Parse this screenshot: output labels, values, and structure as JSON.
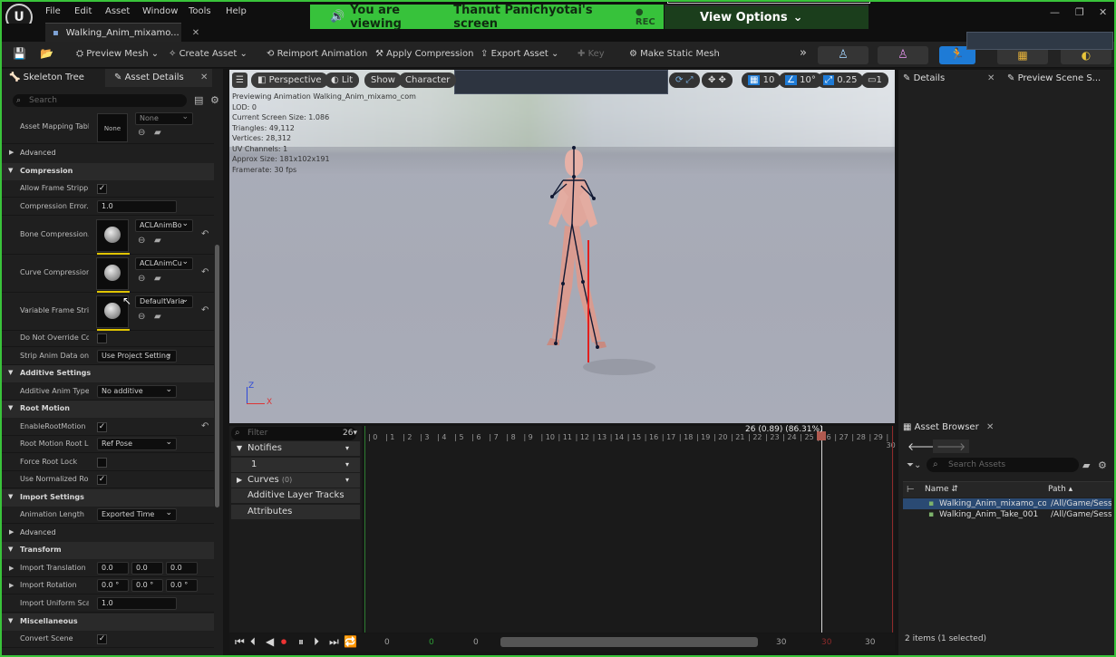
{
  "menubar": {
    "logo": "U",
    "items": [
      "File",
      "Edit",
      "Asset",
      "Window",
      "Tools",
      "Help"
    ],
    "window_controls": [
      "—",
      "❐",
      "✕"
    ]
  },
  "share_banner": {
    "text": "You are viewing",
    "presenter": "Thanut Panichyotai's screen",
    "rec": "● REC",
    "view_options": "View Options"
  },
  "document_tab": {
    "label": "Walking_Anim_mixamo...",
    "close": "✕"
  },
  "toolbar": {
    "preview_mesh": "Preview Mesh",
    "create_asset": "Create Asset",
    "reimport_animation": "Reimport Animation",
    "apply_compression": "Apply Compression",
    "export_asset": "Export Asset",
    "key": "Key",
    "make_static_mesh": "Make Static Mesh"
  },
  "left_panel": {
    "tabs": [
      "Skeleton Tree",
      "Asset Details"
    ],
    "search_placeholder": "Search",
    "asset_mapping_table": {
      "label": "Asset Mapping Table",
      "value": "None",
      "combo": "None"
    },
    "sections": {
      "advanced_1": "Advanced",
      "compression": "Compression",
      "additive_settings": "Additive Settings",
      "root_motion": "Root Motion",
      "import_settings": "Import Settings",
      "advanced_2": "Advanced",
      "transform": "Transform",
      "miscellaneous": "Miscellaneous"
    },
    "rows": {
      "allow_frame_stripping": {
        "label": "Allow Frame Strippi...",
        "checked": "✓"
      },
      "compression_error": {
        "label": "Compression Error...",
        "value": "1.0"
      },
      "bone_compression": {
        "label": "Bone Compression...",
        "combo": "ACLAnimBo"
      },
      "curve_compression": {
        "label": "Curve Compression...",
        "combo": "ACLAnimCu"
      },
      "variable_frame_strip": {
        "label": "Variable Frame Stri...",
        "combo": "DefaultVaria"
      },
      "do_not_override": {
        "label": "Do Not Override Co..."
      },
      "strip_anim_data": {
        "label": "Strip Anim Data on...",
        "combo": "Use Project Setting"
      },
      "additive_anim_type": {
        "label": "Additive Anim Type",
        "combo": "No additive"
      },
      "enable_root_motion": {
        "label": "EnableRootMotion",
        "checked": "✓"
      },
      "root_motion_root_lock": {
        "label": "Root Motion Root L...",
        "combo": "Ref Pose"
      },
      "force_root_lock": {
        "label": "Force Root Lock"
      },
      "use_normalized_root": {
        "label": "Use Normalized Ro...",
        "checked": "✓"
      },
      "animation_length": {
        "label": "Animation Length",
        "combo": "Exported Time"
      },
      "import_translation": {
        "label": "Import Translation",
        "x": "0.0",
        "y": "0.0",
        "z": "0.0"
      },
      "import_rotation": {
        "label": "Import Rotation",
        "x": "0.0 °",
        "y": "0.0 °",
        "z": "0.0 °"
      },
      "import_uniform_scale": {
        "label": "Import Uniform Scale",
        "value": "1.0"
      },
      "convert_scene": {
        "label": "Convert Scene",
        "checked": "✓"
      }
    }
  },
  "viewport": {
    "perspective": "Perspective",
    "lit": "Lit",
    "show": "Show",
    "character": "Character",
    "grid_snap": "10",
    "angle_snap": "10°",
    "scale_snap": "0.25",
    "camera_speed": "1",
    "stats": [
      "Previewing Animation Walking_Anim_mixamo_com",
      "LOD: 0",
      "Current Screen Size: 1.086",
      "Triangles: 49,112",
      "Vertices: 28,312",
      "UV Channels: 1",
      "Approx Size: 181x102x191",
      "Framerate: 30 fps"
    ],
    "axis_z": "Z",
    "axis_x": "X"
  },
  "details_panel": {
    "tab_details": "Details",
    "tab_preview_scene": "Preview Scene S..."
  },
  "asset_browser": {
    "title": "Asset Browser",
    "search_placeholder": "Search Assets",
    "col_name": "Name",
    "col_path": "Path",
    "rows": [
      {
        "name": "Walking_Anim_mixamo_con",
        "path": "/All/Game/Sess"
      },
      {
        "name": "Walking_Anim_Take_001",
        "path": "/All/Game/Sess"
      }
    ],
    "status": "2 items (1 selected)"
  },
  "timeline": {
    "filter_placeholder": "Filter",
    "frame_count": "26",
    "tracks": {
      "notifies": "Notifies",
      "notify_track": "1",
      "curves": "Curves",
      "curves_count": "(0)",
      "additive_layer_tracks": "Additive Layer Tracks",
      "attributes": "Attributes"
    },
    "ruler_ticks": [
      "0",
      "1",
      "2",
      "3",
      "4",
      "5",
      "6",
      "7",
      "8",
      "9",
      "10",
      "11",
      "12",
      "13",
      "14",
      "15",
      "16",
      "17",
      "18",
      "19",
      "20",
      "21",
      "22",
      "23",
      "24",
      "25",
      "26",
      "27",
      "28",
      "29",
      "30"
    ],
    "scrub_label": "26 (0.89) (86.31%)",
    "range_start": "0",
    "range_start_green": "0",
    "range_start_2": "0",
    "range_end": "30",
    "range_end_red": "30",
    "range_end_2": "30"
  },
  "colors": {
    "share_green": "#37c23b",
    "viewport_bg": "#a9acb8",
    "selection_blue": "#2a4a73",
    "accent_blue": "#1e7bd6"
  }
}
